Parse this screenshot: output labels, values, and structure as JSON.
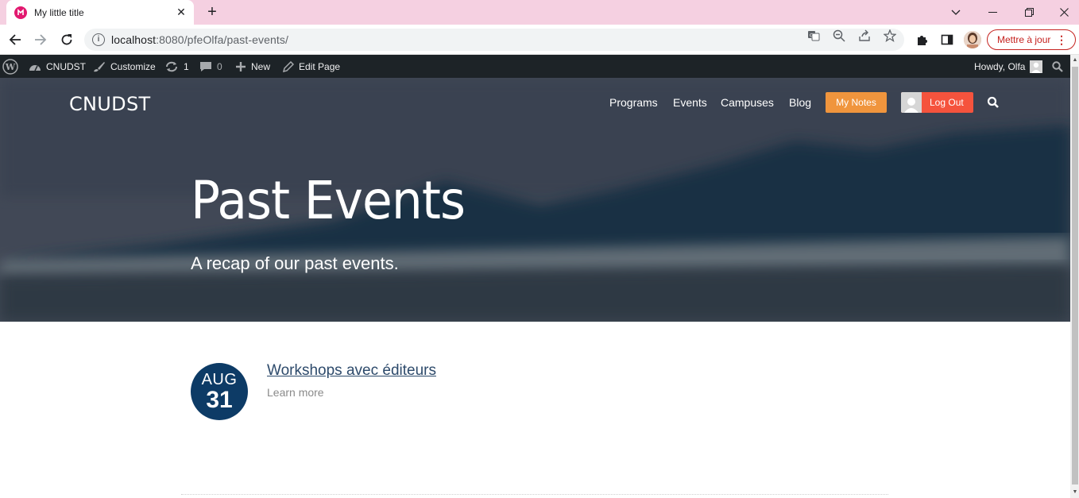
{
  "browser": {
    "tab_title": "My little title",
    "url_host": "localhost",
    "url_rest": ":8080/pfeOlfa/past-events/",
    "update_label": "Mettre à jour"
  },
  "adminbar": {
    "site_name": "CNUDST",
    "customize": "Customize",
    "updates_count": "1",
    "comments_count": "0",
    "new_label": "New",
    "edit_label": "Edit Page",
    "howdy": "Howdy, Olfa"
  },
  "site": {
    "brand": "CNUDST",
    "menu": [
      "Programs",
      "Events",
      "Campuses",
      "Blog"
    ],
    "notes_label": "My Notes",
    "logout_label": "Log Out"
  },
  "hero": {
    "title": "Past Events",
    "subtitle": "A recap of our past events."
  },
  "events": [
    {
      "month": "AUG",
      "day": "31",
      "title": "Workshops avec éditeurs",
      "more": "Learn more"
    }
  ],
  "colors": {
    "tab_strip": "#f5d0e1",
    "adminbar": "#1d2327",
    "notes_button": "#f0953d",
    "logout_button": "#f5533d",
    "date_circle": "#0d3b66",
    "update_button": "#c5221f"
  }
}
